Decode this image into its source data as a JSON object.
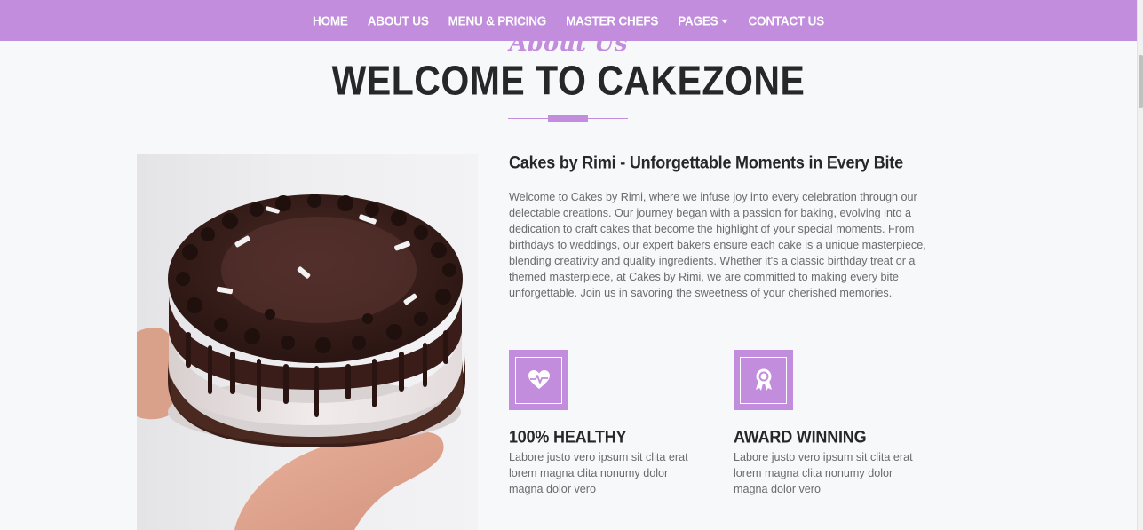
{
  "nav": {
    "items": [
      {
        "label": "HOME"
      },
      {
        "label": "ABOUT US"
      },
      {
        "label": "MENU & PRICING"
      },
      {
        "label": "MASTER CHEFS"
      },
      {
        "label": "PAGES"
      },
      {
        "label": "CONTACT US"
      }
    ]
  },
  "section": {
    "subtitle": "About Us",
    "title": "WELCOME TO CAKEZONE"
  },
  "about": {
    "heading": "Cakes by Rimi - Unforgettable Moments in Every Bite",
    "body": "Welcome to Cakes by Rimi, where we infuse joy into every celebration through our delectable creations. Our journey began with a passion for baking, evolving into a dedication to craft cakes that become the highlight of your special moments. From birthdays to weddings, our expert bakers ensure each cake is a unique masterpiece, blending creativity and quality ingredients. Whether it's a classic birthday treat or a themed masterpiece, at Cakes by Rimi, we are committed to making every bite unforgettable. Join us in savoring the sweetness of your cherished memories."
  },
  "features": [
    {
      "icon": "heart-pulse-icon",
      "title": "100% HEALTHY",
      "text": "Labore justo vero ipsum sit clita erat lorem magna clita nonumy dolor magna dolor vero"
    },
    {
      "icon": "award-icon",
      "title": "AWARD WINNING",
      "text": "Labore justo vero ipsum sit clita erat lorem magna clita nonumy dolor magna dolor vero"
    }
  ],
  "colors": {
    "primary": "#c28ddc",
    "heading": "#272727",
    "text": "#6b6b6b",
    "background": "#f7f8fa"
  }
}
